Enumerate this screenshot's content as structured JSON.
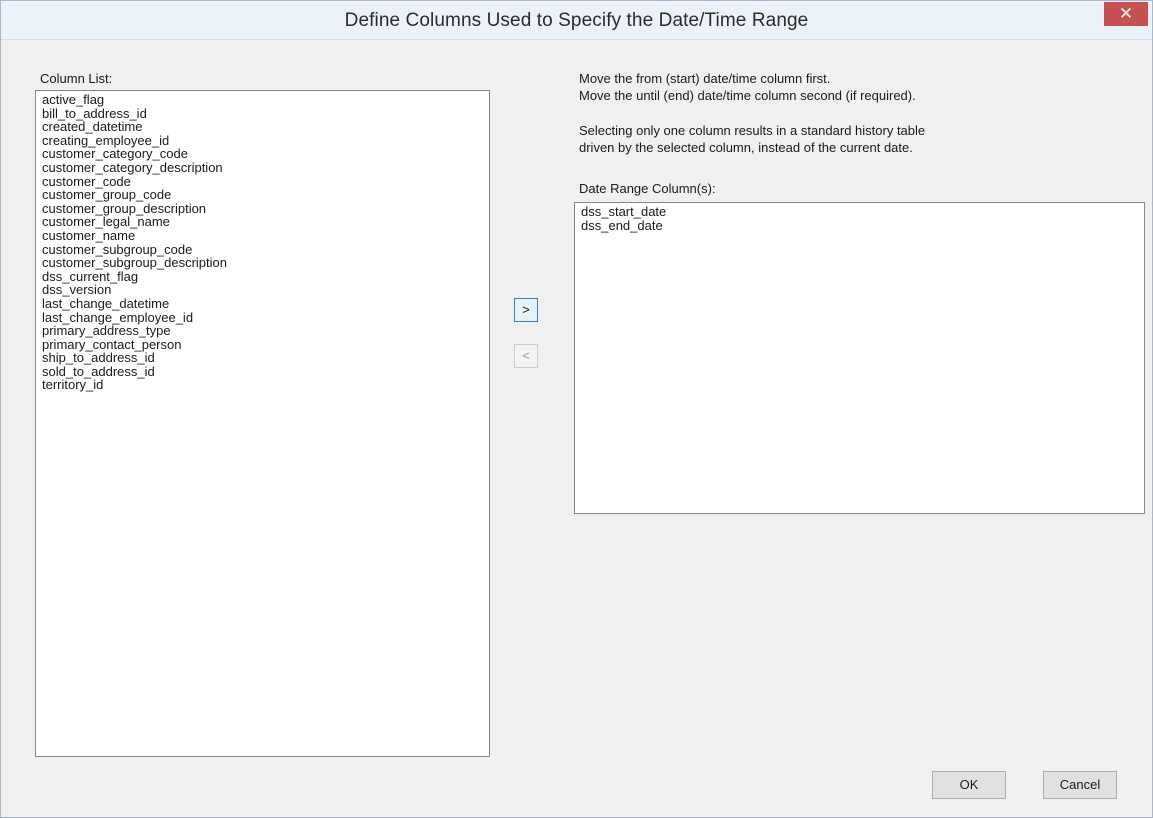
{
  "window": {
    "title": "Define Columns Used to Specify the Date/Time Range",
    "close_glyph": "✕"
  },
  "column_list": {
    "label": "Column List:",
    "items": [
      "active_flag",
      "bill_to_address_id",
      "created_datetime",
      "creating_employee_id",
      "customer_category_code",
      "customer_category_description",
      "customer_code",
      "customer_group_code",
      "customer_group_description",
      "customer_legal_name",
      "customer_name",
      "customer_subgroup_code",
      "customer_subgroup_description",
      "dss_current_flag",
      "dss_version",
      "last_change_datetime",
      "last_change_employee_id",
      "primary_address_type",
      "primary_contact_person",
      "ship_to_address_id",
      "sold_to_address_id",
      "territory_id"
    ]
  },
  "instructions": {
    "line1": "Move the from (start) date/time column first.",
    "line2": "Move the until (end) date/time column second (if required).",
    "line3": "Selecting only one column results in a standard history table",
    "line4": "driven by the selected column, instead of the current date."
  },
  "date_range": {
    "label": "Date Range Column(s):",
    "items": [
      "dss_start_date",
      "dss_end_date"
    ]
  },
  "buttons": {
    "move_right": ">",
    "move_left": "<",
    "ok": "OK",
    "cancel": "Cancel"
  },
  "colors": {
    "close_button": "#c75050",
    "active_button_border": "#3c7fb1",
    "window_background": "#f0f0f0"
  }
}
